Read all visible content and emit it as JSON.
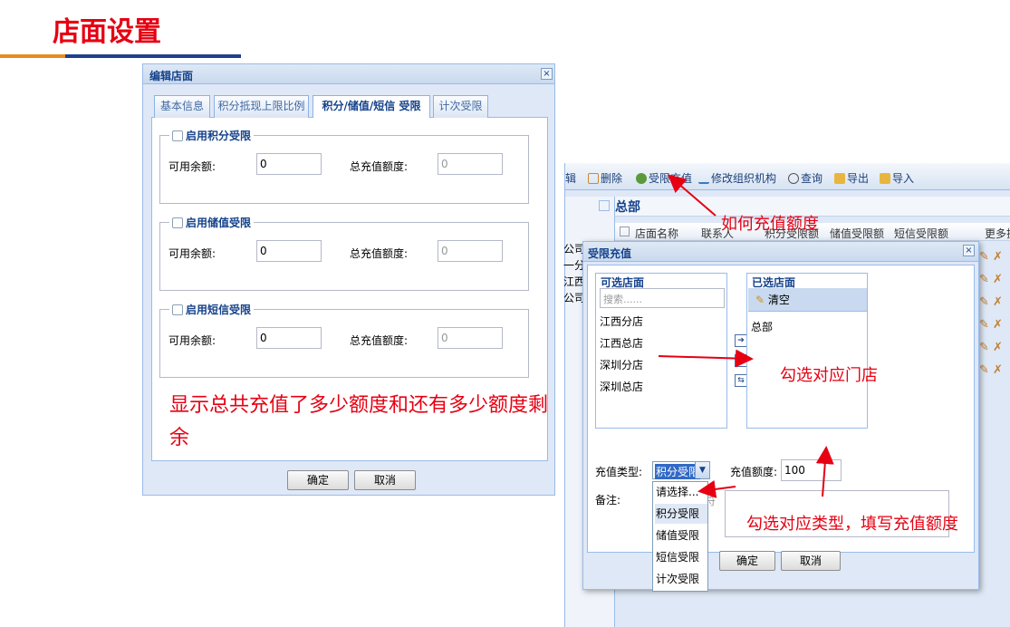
{
  "page_title": "店面设置",
  "edit_dialog": {
    "title": "编辑店面",
    "tabs": [
      "基本信息",
      "积分抵现上限比例",
      "积分/储值/短信 受限",
      "计次受限"
    ],
    "active_tab": 2,
    "sections": [
      {
        "legend": "启用积分受限",
        "avail_label": "可用余额:",
        "avail_value": "0",
        "total_label": "总充值额度:",
        "total_value": "0"
      },
      {
        "legend": "启用储值受限",
        "avail_label": "可用余额:",
        "avail_value": "0",
        "total_label": "总充值额度:",
        "total_value": "0"
      },
      {
        "legend": "启用短信受限",
        "avail_label": "可用余额:",
        "avail_value": "0",
        "total_label": "总充值额度:",
        "total_value": "0"
      }
    ],
    "ok": "确定",
    "cancel": "取消",
    "note": "显示总共充值了多少额度和还有多少额度剩余"
  },
  "app": {
    "toolbar": [
      "辑",
      "删除",
      "受限充值",
      "修改组织机构",
      "查询",
      "导出",
      "导入"
    ],
    "grid_title": "总部",
    "columns": [
      "店面名称",
      "联系人",
      "积分受限额",
      "储值受限额",
      "短信受限额",
      "更多操"
    ],
    "left_rows": [
      "公司",
      "一分",
      "江西一",
      "公司"
    ]
  },
  "recharge_dialog": {
    "title": "受限充值",
    "available_title": "可选店面",
    "search_placeholder": "搜索......",
    "stores": [
      "江西分店",
      "江西总店",
      "深圳分店",
      "深圳总店"
    ],
    "selected_title": "已选店面",
    "clear": "清空",
    "selected": [
      "总部"
    ],
    "type_label": "充值类型:",
    "type_value": "积分受限",
    "amount_label": "充值额度:",
    "amount_value": "100",
    "remark_label": "备注:",
    "remark_hint": "字符",
    "options": [
      "请选择...",
      "积分受限",
      "储值受限",
      "短信受限",
      "计次受限"
    ],
    "ok": "确定",
    "cancel": "取消"
  },
  "annotations": {
    "how": "如何充值额度",
    "pick_store": "勾选对应门店",
    "pick_type": "勾选对应类型，填写充值额度"
  },
  "colors": {
    "accent_red": "#e60012",
    "bar_orange": "#e98a1e",
    "bar_blue": "#1f3f8f",
    "ext_blue": "#15428b"
  }
}
